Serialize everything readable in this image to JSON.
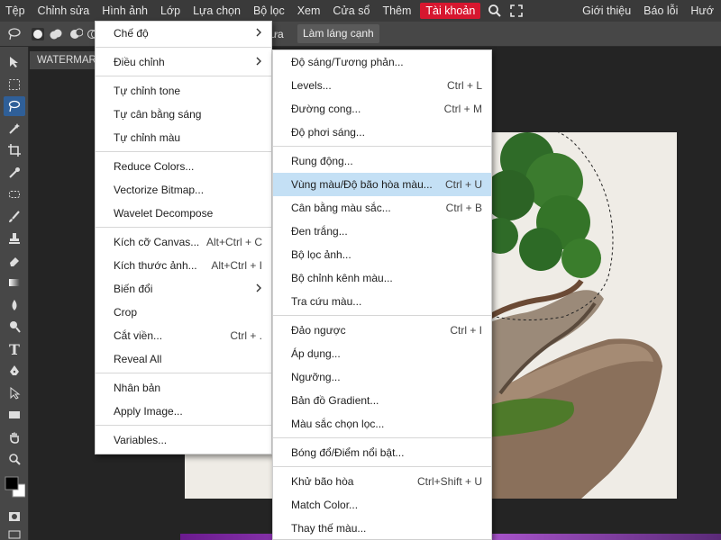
{
  "menubar": {
    "items": [
      "Tệp",
      "Chỉnh sửa",
      "Hình ảnh",
      "Lớp",
      "Lựa chọn",
      "Bộ lọc",
      "Xem",
      "Cửa sổ",
      "Thêm"
    ],
    "account": "Tài khoản",
    "right": [
      "Giới thiệu",
      "Báo lỗi",
      "Hướ"
    ]
  },
  "optbar": {
    "partial_text": "ưa",
    "refine_edge": "Làm láng cạnh"
  },
  "tab": {
    "title": "WATERMARK"
  },
  "image_menu": {
    "items": [
      {
        "label": "Chế độ",
        "submenu": true
      },
      {
        "sep": true
      },
      {
        "label": "Điều chỉnh",
        "submenu": true
      },
      {
        "sep": true
      },
      {
        "label": "Tự chỉnh tone"
      },
      {
        "label": "Tự cân bằng sáng"
      },
      {
        "label": "Tự chỉnh màu"
      },
      {
        "sep": true
      },
      {
        "label": "Reduce Colors..."
      },
      {
        "label": "Vectorize Bitmap..."
      },
      {
        "label": "Wavelet Decompose"
      },
      {
        "sep": true
      },
      {
        "label": "Kích cỡ Canvas...",
        "shortcut": "Alt+Ctrl + C"
      },
      {
        "label": "Kích thước ảnh...",
        "shortcut": "Alt+Ctrl + I"
      },
      {
        "label": "Biến đổi",
        "submenu": true
      },
      {
        "label": "Crop"
      },
      {
        "label": "Cắt viền...",
        "shortcut": "Ctrl + ."
      },
      {
        "label": "Reveal All"
      },
      {
        "sep": true
      },
      {
        "label": "Nhân bản"
      },
      {
        "label": "Apply Image..."
      },
      {
        "sep": true
      },
      {
        "label": "Variables..."
      }
    ]
  },
  "adjust_menu": {
    "items": [
      {
        "label": "Độ sáng/Tương phản..."
      },
      {
        "label": "Levels...",
        "shortcut": "Ctrl + L"
      },
      {
        "label": "Đường cong...",
        "shortcut": "Ctrl + M"
      },
      {
        "label": "Độ phơi sáng..."
      },
      {
        "sep": true
      },
      {
        "label": "Rung động..."
      },
      {
        "label": "Vùng màu/Độ bão hòa màu...",
        "shortcut": "Ctrl + U",
        "highlighted": true
      },
      {
        "label": "Cân bằng màu sắc...",
        "shortcut": "Ctrl + B"
      },
      {
        "label": "Đen trắng..."
      },
      {
        "label": "Bộ lọc ảnh..."
      },
      {
        "label": "Bộ chỉnh kênh màu..."
      },
      {
        "label": "Tra cứu màu..."
      },
      {
        "sep": true
      },
      {
        "label": "Đảo ngược",
        "shortcut": "Ctrl + I"
      },
      {
        "label": "Áp dụng..."
      },
      {
        "label": "Ngưỡng..."
      },
      {
        "label": "Bản đồ Gradient..."
      },
      {
        "label": "Màu sắc chọn lọc..."
      },
      {
        "sep": true
      },
      {
        "label": "Bóng đổ/Điểm nổi bật..."
      },
      {
        "sep": true
      },
      {
        "label": "Khử bão hòa",
        "shortcut": "Ctrl+Shift + U"
      },
      {
        "label": "Match Color..."
      },
      {
        "label": "Thay thế màu..."
      }
    ]
  },
  "colors": {
    "accent_account": "#d7172f",
    "highlight": "#c4e0f5",
    "active_tool": "#2f5f98"
  }
}
